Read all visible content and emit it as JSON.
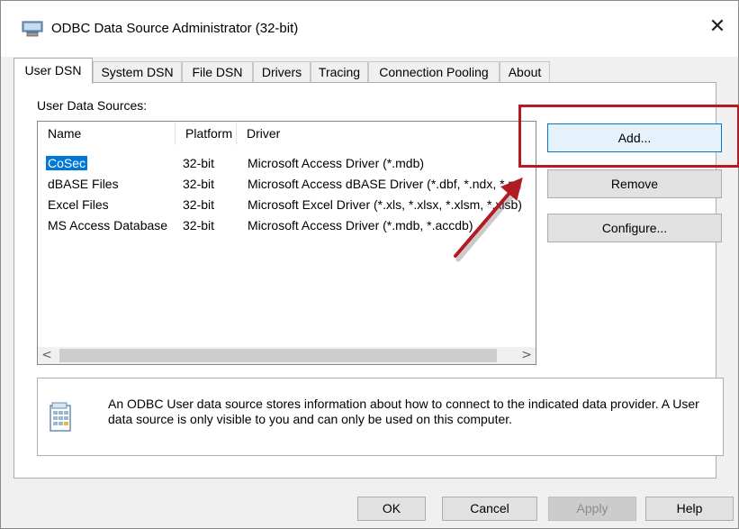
{
  "window": {
    "title": "ODBC Data Source Administrator (32-bit)",
    "close_glyph": "✕",
    "icon": "odbc-app-icon"
  },
  "tabs": [
    {
      "label": "User DSN",
      "active": true
    },
    {
      "label": "System DSN",
      "active": false
    },
    {
      "label": "File DSN",
      "active": false
    },
    {
      "label": "Drivers",
      "active": false
    },
    {
      "label": "Tracing",
      "active": false
    },
    {
      "label": "Connection Pooling",
      "active": false
    },
    {
      "label": "About",
      "active": false
    }
  ],
  "user_dsn": {
    "group_label": "User Data Sources:",
    "columns": [
      "Name",
      "Platform",
      "Driver"
    ],
    "rows": [
      {
        "name": "CoSec",
        "platform": "32-bit",
        "driver": "Microsoft Access Driver (*.mdb)",
        "selected": true
      },
      {
        "name": "dBASE Files",
        "platform": "32-bit",
        "driver": "Microsoft Access dBASE Driver (*.dbf, *.ndx, *.m",
        "selected": false
      },
      {
        "name": "Excel Files",
        "platform": "32-bit",
        "driver": "Microsoft Excel Driver (*.xls, *.xlsx, *.xlsm, *.xlsb)",
        "selected": false
      },
      {
        "name": "MS Access Database",
        "platform": "32-bit",
        "driver": "Microsoft Access Driver (*.mdb, *.accdb)",
        "selected": false
      }
    ],
    "scroll_left": "<",
    "scroll_right": ">"
  },
  "side_buttons": {
    "add": "Add...",
    "remove": "Remove",
    "configure": "Configure..."
  },
  "info": {
    "icon": "data-source-icon",
    "text": "An ODBC User data source stores information about how to connect to the indicated data provider.  A User data source is only visible to you and can only be used on this computer."
  },
  "footer_buttons": {
    "ok": "OK",
    "cancel": "Cancel",
    "apply": "Apply",
    "help": "Help"
  },
  "colors": {
    "selection": "#0078d7",
    "annotation": "#b31b24"
  }
}
